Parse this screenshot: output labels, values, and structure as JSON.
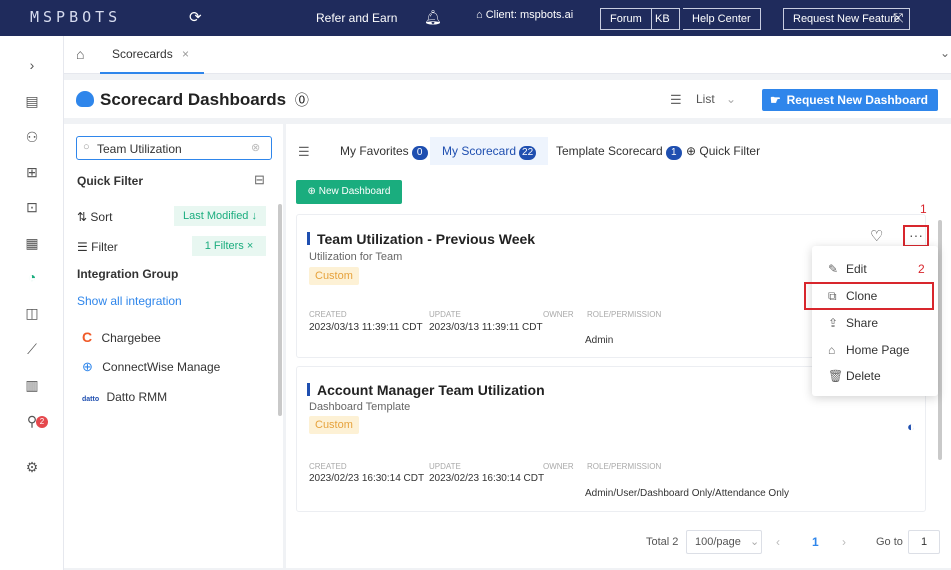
{
  "topbar": {
    "logo": "MSPBOTS",
    "refer": "Refer and Earn",
    "client": "Client: mspbots.ai",
    "forum": "Forum",
    "kb": "KB",
    "help": "Help Center",
    "request_feature": "Request New Feature"
  },
  "tabs": {
    "open_tab": "Scorecards",
    "close": "×"
  },
  "header": {
    "title": "Scorecard Dashboards",
    "view_label": "List",
    "request_dashboard": "Request New Dashboard"
  },
  "left": {
    "search_value": "Team Utilization",
    "quick_filter": "Quick Filter",
    "sort_label": "Sort",
    "sort_value": "Last Modified ↓",
    "filter_label": "Filter",
    "filter_value": "1 Filters ×",
    "integration_group": "Integration Group",
    "show_all": "Show all integration",
    "integrations": [
      "Chargebee",
      "ConnectWise Manage",
      "Datto RMM"
    ],
    "datto_logo": "datto"
  },
  "main": {
    "tabs": [
      {
        "label": "My Favorites",
        "count": "0"
      },
      {
        "label": "My Scorecard",
        "count": "22"
      },
      {
        "label": "Template Scorecard",
        "count": "1"
      }
    ],
    "quick_filter": "Quick Filter",
    "new_dashboard": "New Dashboard",
    "meta_headers": {
      "created": "CREATED",
      "update": "UPDATE",
      "owner": "OWNER",
      "role": "ROLE/PERMISSION"
    },
    "cards": [
      {
        "title": "Team Utilization - Previous Week",
        "subtitle": "Utilization for Team",
        "tag": "Custom",
        "created": "2023/03/13 11:39:11 CDT",
        "update": "2023/03/13 11:39:11 CDT",
        "role": "Admin"
      },
      {
        "title": "Account Manager Team Utilization",
        "subtitle": "Dashboard Template",
        "tag": "Custom",
        "created": "2023/02/23 16:30:14 CDT",
        "update": "2023/02/23 16:30:14 CDT",
        "role": "Admin/User/Dashboard Only/Attendance Only"
      }
    ],
    "pagination": {
      "total": "Total 2",
      "per_page": "100/page",
      "current": "1",
      "goto_label": "Go to",
      "goto_value": "1"
    }
  },
  "menu": {
    "items": [
      "Edit",
      "Clone",
      "Share",
      "Home Page",
      "Delete"
    ]
  },
  "annotations": {
    "step1": "1",
    "step2": "2"
  },
  "sidebar_badge": "2",
  "colors": {
    "topbar": "#1f2b5c",
    "accent": "#2f86eb",
    "green": "#1aad7e",
    "highlight_red": "#d8262d",
    "tag_bg": "#fdf1d5"
  }
}
